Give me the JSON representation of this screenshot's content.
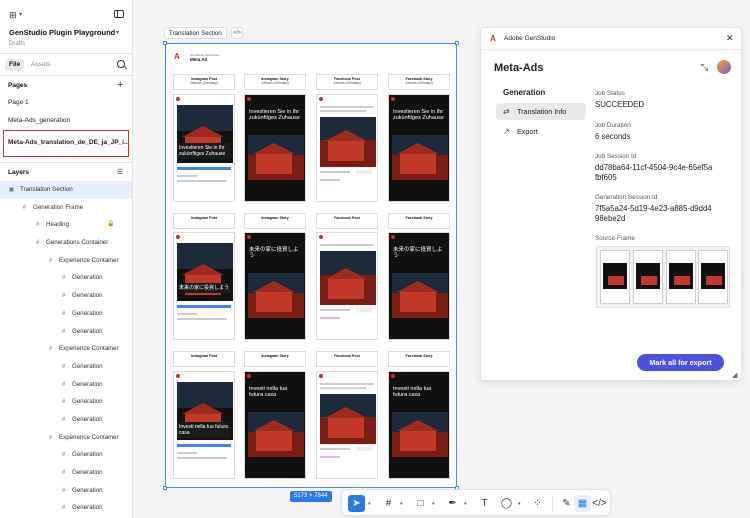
{
  "app": {
    "project_name": "GenStudio Plugin Playground",
    "project_status": "Drafts"
  },
  "tabs": {
    "file": "File",
    "assets": "Assets"
  },
  "pages": {
    "title": "Pages",
    "items": [
      {
        "label": "Page 1"
      },
      {
        "label": "Meta-Ads_generation"
      },
      {
        "label": "Meta-Ads_translation_de_DE_ja_JP_i..."
      }
    ]
  },
  "layers": {
    "title": "Layers",
    "items": [
      {
        "label": "Translation Section",
        "icon": "section-icon"
      },
      {
        "label": "Generation Frame",
        "icon": "frame-icon"
      },
      {
        "label": "Heading",
        "icon": "frame-icon"
      },
      {
        "label": "Generations Container",
        "icon": "frame-icon"
      },
      {
        "label": "Experience Container",
        "icon": "frame-icon"
      },
      {
        "label": "Generation",
        "icon": "frame-icon"
      },
      {
        "label": "Generation",
        "icon": "frame-icon"
      },
      {
        "label": "Generation",
        "icon": "frame-icon"
      },
      {
        "label": "Generation",
        "icon": "frame-icon"
      },
      {
        "label": "Experience Container",
        "icon": "frame-icon"
      },
      {
        "label": "Generation",
        "icon": "frame-icon"
      },
      {
        "label": "Generation",
        "icon": "frame-icon"
      },
      {
        "label": "Generation",
        "icon": "frame-icon"
      },
      {
        "label": "Generation",
        "icon": "frame-icon"
      },
      {
        "label": "Experience Container",
        "icon": "frame-icon"
      },
      {
        "label": "Generation",
        "icon": "frame-icon"
      },
      {
        "label": "Generation",
        "icon": "frame-icon"
      },
      {
        "label": "Generation",
        "icon": "frame-icon"
      },
      {
        "label": "Generation",
        "icon": "frame-icon"
      }
    ]
  },
  "canvas": {
    "frame_label": "Translation Section",
    "frame_dimensions": "5173 × 7844",
    "meta_sub": "GenStudio Generation",
    "meta_title": "Meta Ad",
    "columns": [
      {
        "title": "Instagram Post",
        "lang": "German (Germany)",
        "meta": "Variant 1 of 4"
      },
      {
        "title": "Instagram Story",
        "lang": "German (Germany)",
        "meta": "Variant 2 of 4"
      },
      {
        "title": "Facebook Post",
        "lang": "German (Germany)",
        "meta": "Variant 3 of 4"
      },
      {
        "title": "Facebook Story",
        "lang": "German (Germany)",
        "meta": "Variant 4 of 4"
      }
    ],
    "row_headers": [
      [
        "Instagram Post",
        "Instagram Story",
        "Facebook Post",
        "Facebook Story"
      ],
      [
        "Instagram Post",
        "Instagram Story",
        "Facebook Post",
        "Facebook Story"
      ],
      [
        "Instagram Post",
        "Instagram Story",
        "Facebook Post",
        "Facebook Story"
      ]
    ],
    "headlines": [
      "Investieren Sie in Ihr zukünftiges Zuhause",
      "未来の家に投資しよう",
      "Investi nella tua futura casa"
    ]
  },
  "plugin": {
    "header_title": "Adobe GenStudio",
    "title": "Meta-Ads",
    "nav_heading": "Generation",
    "nav_items": [
      {
        "label": "Translation Info",
        "icon": "translate-icon"
      },
      {
        "label": "Export",
        "icon": "export-icon"
      }
    ],
    "fields": [
      {
        "key": "Job Status",
        "value": "SUCCEEDED"
      },
      {
        "key": "Job Duration",
        "value": "6 seconds"
      },
      {
        "key": "Job Session Id",
        "value": "dd78ba64-11cf-4504-9c4e-65ef5afbf605"
      },
      {
        "key": "Generation Session Id",
        "value": "7f5a5a24-5d19-4e23-a885-d9dd498ebe2d"
      }
    ],
    "source_frame_label": "Source Frame",
    "export_button": "Mark all for export"
  },
  "colors": {
    "accent": "#4b52dd",
    "selection": "#2b79e8",
    "highlight_border": "#d92b2b",
    "adobe_red": "#d12c2c"
  }
}
